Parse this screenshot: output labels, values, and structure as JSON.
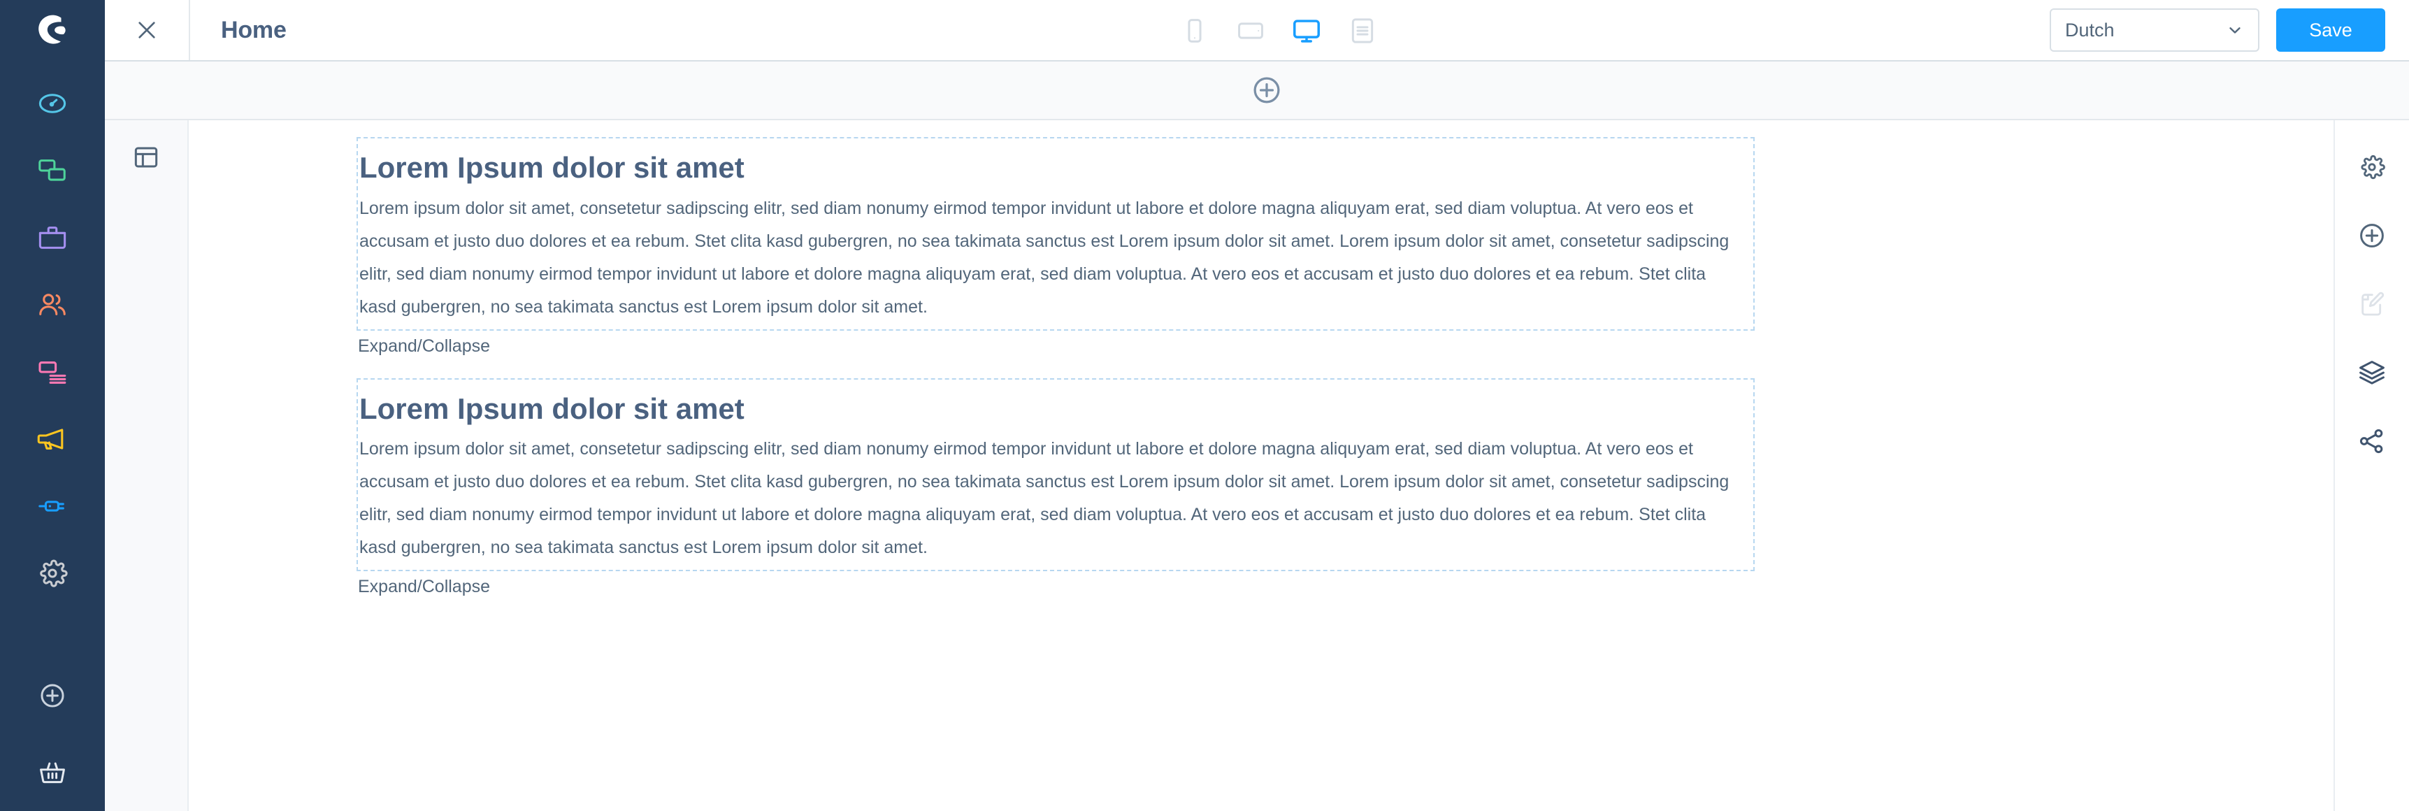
{
  "brand": {
    "logo_name": "shopware-logo",
    "logo_color": "#ffffff",
    "bar_color": "#243c5a"
  },
  "topbar": {
    "close_label": "close-icon",
    "page_title": "Home",
    "language": {
      "value": "Dutch",
      "chevron": "chevron-down-icon"
    },
    "save_label": "Save",
    "save_color": "#189eff",
    "devices": [
      {
        "name": "mobile",
        "active": false
      },
      {
        "name": "tablet",
        "active": false
      },
      {
        "name": "desktop",
        "active": true
      },
      {
        "name": "form",
        "active": false
      }
    ]
  },
  "stage_toolbar": {
    "add_section_icon": "plus-circle-icon"
  },
  "section_rail": {
    "layout_icon": "layout-icon"
  },
  "sidebar": {
    "items": [
      {
        "name": "dashboard",
        "icon": "dashboard-icon",
        "color": "#55c6e8"
      },
      {
        "name": "catalogues",
        "icon": "catalogue-icon",
        "color": "#4ed39a"
      },
      {
        "name": "orders",
        "icon": "briefcase-icon",
        "color": "#a48ff0"
      },
      {
        "name": "customers",
        "icon": "customers-icon",
        "color": "#f88962"
      },
      {
        "name": "content",
        "icon": "content-icon",
        "color": "#ff79b4"
      },
      {
        "name": "marketing",
        "icon": "megaphone-icon",
        "color": "#fcc520"
      },
      {
        "name": "extensions",
        "icon": "plug-icon",
        "color": "#189eff"
      },
      {
        "name": "settings",
        "icon": "gear-icon",
        "color": "#c9ccd1"
      }
    ],
    "bottom_items": [
      {
        "name": "add",
        "icon": "plus-circle-icon",
        "color": "#c9d2dd"
      },
      {
        "name": "storefront",
        "icon": "basket-icon",
        "color": "#e5eaf0"
      }
    ]
  },
  "right_rail": {
    "items": [
      {
        "name": "settings",
        "icon": "gear-icon",
        "disabled": false
      },
      {
        "name": "add-element",
        "icon": "plus-circle-icon",
        "disabled": false
      },
      {
        "name": "edit-content",
        "icon": "edit-document-icon",
        "disabled": true
      },
      {
        "name": "layers",
        "icon": "layers-icon",
        "disabled": false
      },
      {
        "name": "share",
        "icon": "share-icon",
        "disabled": false
      }
    ]
  },
  "content": {
    "blocks": [
      {
        "heading": "Lorem Ipsum dolor sit amet",
        "text": "Lorem ipsum dolor sit amet, consetetur sadipscing elitr, sed diam nonumy eirmod tempor invidunt ut labore et dolore magna aliquyam erat, sed diam voluptua. At vero eos et accusam et justo duo dolores et ea rebum. Stet clita kasd gubergren, no sea takimata sanctus est Lorem ipsum dolor sit amet. Lorem ipsum dolor sit amet, consetetur sadipscing elitr, sed diam nonumy eirmod tempor invidunt ut labore et dolore magna aliquyam erat, sed diam voluptua. At vero eos et accusam et justo duo dolores et ea rebum. Stet clita kasd gubergren, no sea takimata sanctus est Lorem ipsum dolor sit amet.",
        "expand_label": "Expand/Collapse"
      },
      {
        "heading": "Lorem Ipsum dolor sit amet",
        "text": "Lorem ipsum dolor sit amet, consetetur sadipscing elitr, sed diam nonumy eirmod tempor invidunt ut labore et dolore magna aliquyam erat, sed diam voluptua. At vero eos et accusam et justo duo dolores et ea rebum. Stet clita kasd gubergren, no sea takimata sanctus est Lorem ipsum dolor sit amet. Lorem ipsum dolor sit amet, consetetur sadipscing elitr, sed diam nonumy eirmod tempor invidunt ut labore et dolore magna aliquyam erat, sed diam voluptua. At vero eos et accusam et justo duo dolores et ea rebum. Stet clita kasd gubergren, no sea takimata sanctus est Lorem ipsum dolor sit amet.",
        "expand_label": "Expand/Collapse"
      }
    ]
  }
}
